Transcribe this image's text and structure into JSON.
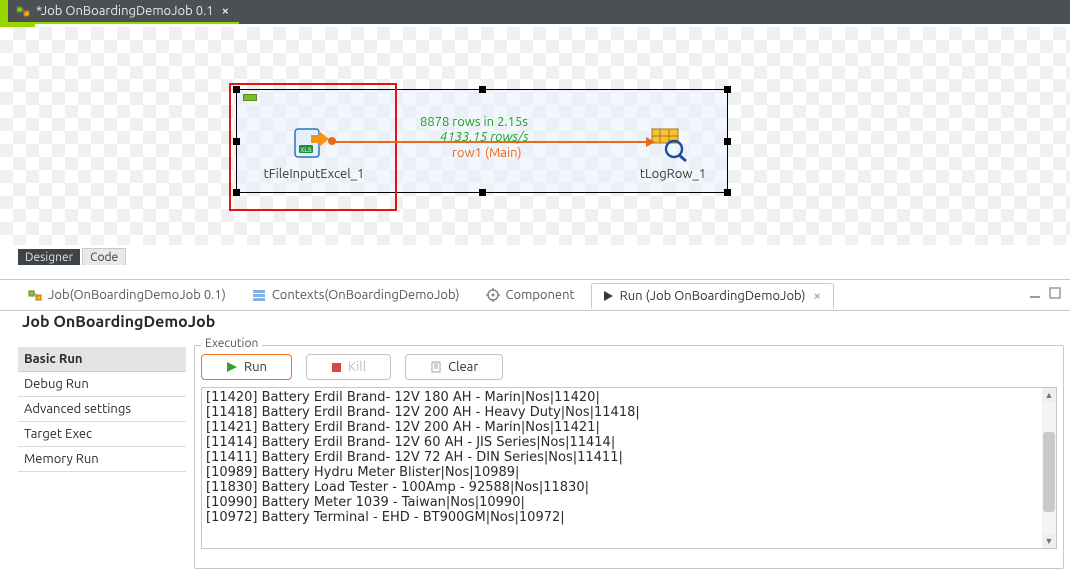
{
  "topbar": {
    "tab_label": "*Job OnBoardingDemoJob 0.1"
  },
  "canvas": {
    "component_a": "tFileInputExcel_1",
    "component_b": "tLogRow_1",
    "stats_rows": "8878 rows in 2.15s",
    "stats_rate": "4133.15 rows/s",
    "flow_label": "row1 (Main)"
  },
  "mini_tabs": {
    "designer": "Designer",
    "code": "Code"
  },
  "prop_tabs": {
    "job": "Job(OnBoardingDemoJob 0.1)",
    "contexts": "Contexts(OnBoardingDemoJob)",
    "component": "Component",
    "run": "Run (Job OnBoardingDemoJob)"
  },
  "panel": {
    "title": "Job OnBoardingDemoJob"
  },
  "run_modes": {
    "items": [
      {
        "label": "Basic Run"
      },
      {
        "label": "Debug Run"
      },
      {
        "label": "Advanced settings"
      },
      {
        "label": "Target Exec"
      },
      {
        "label": "Memory Run"
      }
    ]
  },
  "execution": {
    "legend": "Execution",
    "run_btn": "Run",
    "kill_btn": "Kill",
    "clear_btn": "Clear",
    "log": [
      "[11420] Battery Erdil Brand- 12V 180 AH - Marin|Nos|11420|",
      "[11418] Battery Erdil Brand- 12V 200 AH - Heavy Duty|Nos|11418|",
      "[11421] Battery Erdil Brand- 12V 200 AH - Marin|Nos|11421|",
      "[11414] Battery Erdil Brand- 12V 60 AH - JIS Series|Nos|11414|",
      "[11411] Battery Erdil Brand- 12V 72 AH - DIN Series|Nos|11411|",
      "[10989] Battery Hydru Meter Blister|Nos|10989|",
      "[11830] Battery Load Tester - 100Amp - 92588|Nos|11830|",
      "[10990] Battery Meter 1039 - Taiwan|Nos|10990|",
      "[10972] Battery Terminal - EHD - BT900GM|Nos|10972|"
    ]
  }
}
